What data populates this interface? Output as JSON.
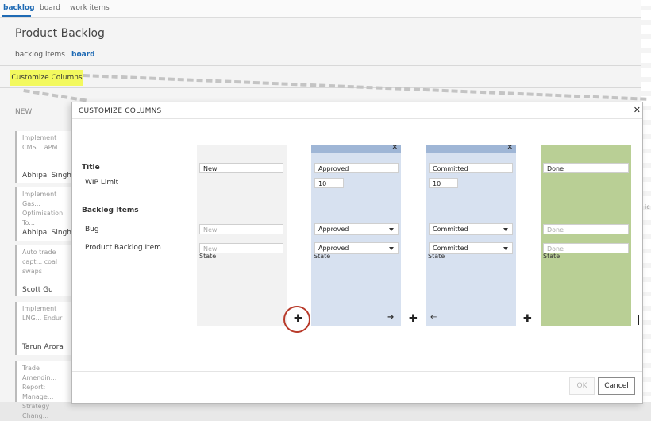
{
  "topnav": {
    "tabs": [
      "backlog",
      "board",
      "work items"
    ]
  },
  "page_title": "Product Backlog",
  "subtabs": [
    "backlog items",
    "board"
  ],
  "customize_button": "Customize Columns",
  "board": {
    "first_column_header": "NEW",
    "cards": [
      {
        "title": "Implement CMS... aPM",
        "owner": "Abhipal Singh"
      },
      {
        "title": "Implement Gas... Optimisation To...",
        "owner": "Abhipal Singh"
      },
      {
        "title": "Auto trade capt... coal swaps",
        "owner": "Scott Gu"
      },
      {
        "title": "Implement LNG... Endur",
        "owner": "Tarun Arora"
      },
      {
        "title": "Trade Amendin... Report: Manage... Strategy Chang...",
        "owner": ""
      }
    ]
  },
  "dialog": {
    "title": "CUSTOMIZE COLUMNS",
    "labels": {
      "title": "Title",
      "wip_limit": "WIP Limit",
      "backlog_items": "Backlog Items",
      "bug": "Bug",
      "pbi": "Product Backlog Item",
      "state": "State"
    },
    "columns": [
      {
        "title": "New",
        "wip": "",
        "bug_state": "New",
        "pbi_state": "New"
      },
      {
        "title": "Approved",
        "wip": "10",
        "bug_state": "Approved",
        "pbi_state": "Approved"
      },
      {
        "title": "Committed",
        "wip": "10",
        "bug_state": "Committed",
        "pbi_state": "Committed"
      },
      {
        "title": "Done",
        "wip": "",
        "bug_state": "Done",
        "pbi_state": "Done"
      }
    ],
    "ok_label": "OK",
    "cancel_label": "Cancel"
  },
  "colors": {
    "accent": "#1e6ab4",
    "highlight": "#f3f95e",
    "column_blue": "#d7e1f0",
    "column_header_blue": "#9fb6d6",
    "column_green": "#b9cf95",
    "column_gray": "#f2f2f2",
    "circle_red": "#b83a2a"
  }
}
